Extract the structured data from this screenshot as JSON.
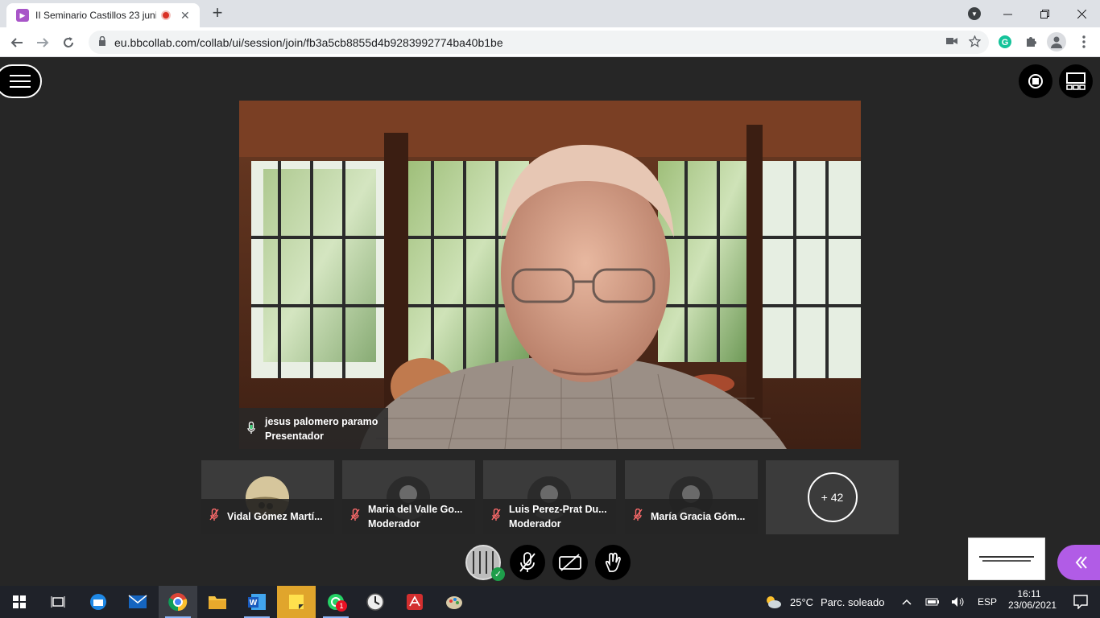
{
  "browser": {
    "tab_title": "II Seminario Castillos 23 junio",
    "tab_close": "✕",
    "new_tab": "+",
    "url": "eu.bbcollab.com/collab/ui/session/join/fb3a5cb8855d4b9283992774ba40b1be"
  },
  "presenter": {
    "name": "jesus palomero paramo",
    "role": "Presentador"
  },
  "participants": [
    {
      "name": "Vidal Gómez Martí...",
      "role": ""
    },
    {
      "name": "Maria del Valle Go...",
      "role": "Moderador"
    },
    {
      "name": "Luis Perez-Prat Du...",
      "role": "Moderador"
    },
    {
      "name": "María Gracia Góm...",
      "role": ""
    }
  ],
  "more_participants": "+ 42",
  "taskbar": {
    "weather_temp": "25°C",
    "weather_desc": "Parc. soleado",
    "lang": "ESP",
    "time": "16:11",
    "date": "23/06/2021",
    "whatsapp_badge": "1"
  },
  "colors": {
    "accent": "#b15ce6",
    "rec": "#d93025",
    "ok": "#1e9e4a",
    "mic_off": "#ff6b6b"
  }
}
